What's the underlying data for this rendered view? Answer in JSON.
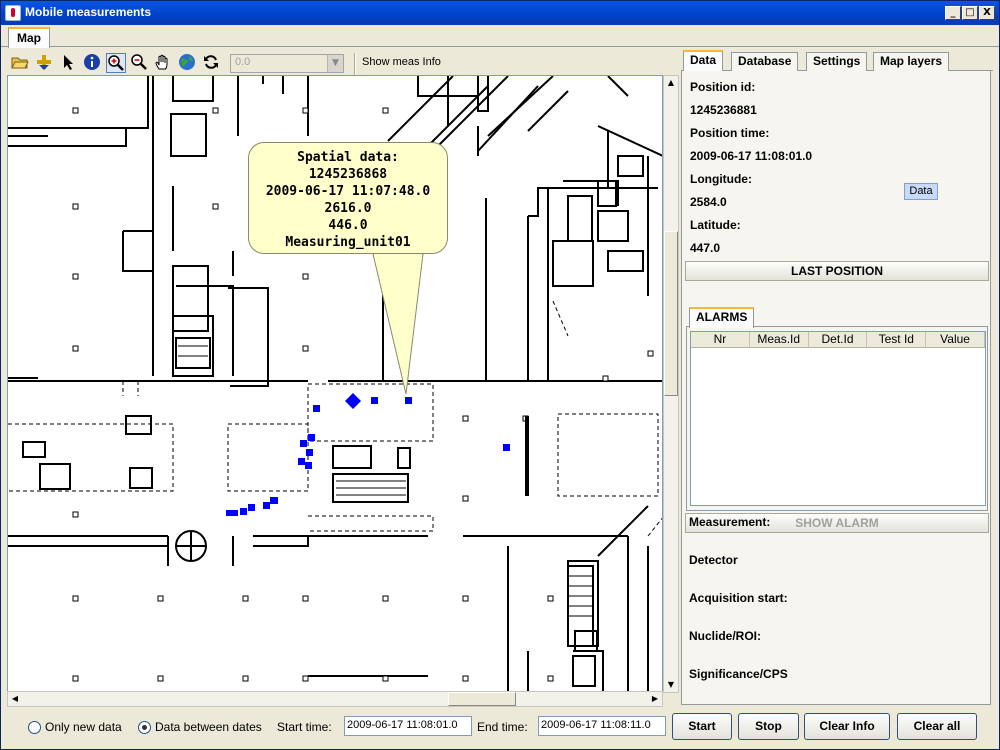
{
  "window": {
    "title": "Mobile measurements",
    "controls": [
      "_",
      "□",
      "X"
    ]
  },
  "top_tabs": [
    {
      "label": "Map",
      "active": true
    }
  ],
  "toolbar": {
    "tools": [
      "open-folder-icon",
      "add-point-icon",
      "pointer-icon",
      "info-icon",
      "zoom-in-icon",
      "zoom-out-icon",
      "pan-hand-icon",
      "globe-icon",
      "refresh-icon"
    ],
    "selected_tool": "zoom-in-icon",
    "zoom_combo_value": "0.0",
    "show_meas_info_label": "Show meas Info"
  },
  "map": {
    "callout": {
      "line1": "Spatial data:",
      "line2": "1245236868",
      "line3": "2009-06-17 11:07:48.0",
      "line4": "2616.0",
      "line5": "446.0",
      "line6": "Measuring_unit01"
    },
    "marker_color": "#0000ff",
    "callout_color": "#ffffcc"
  },
  "right_panel": {
    "tabs": [
      {
        "label": "Data",
        "active": true
      },
      {
        "label": "Database",
        "active": false
      },
      {
        "label": "Settings",
        "active": false
      },
      {
        "label": "Map layers",
        "active": false
      }
    ],
    "position_id_label": "Position id:",
    "position_id_value": "1245236881",
    "position_time_label": "Position time:",
    "position_time_value": "2009-06-17 11:08:01.0",
    "longitude_label": "Longitude:",
    "longitude_value": "2584.0",
    "latitude_label": "Latitude:",
    "latitude_value": "447.0",
    "data_badge": "Data",
    "last_position_button": "LAST POSITION",
    "alarms_tab": "ALARMS",
    "alarm_columns": [
      "Nr",
      "Meas.Id",
      "Det.Id",
      "Test Id",
      "Value"
    ],
    "show_alarm_button": "SHOW ALARM",
    "measurement_label": "Measurement:",
    "detector_label": "Detector",
    "acquisition_start_label": "Acquisition start:",
    "nuclide_label": "Nuclide/ROI:",
    "significance_label": "Significance/CPS"
  },
  "bottom_bar": {
    "radio_only_new": {
      "label": "Only new data",
      "selected": false
    },
    "radio_between_dates": {
      "label": "Data between dates",
      "selected": true
    },
    "start_time_label": "Start time:",
    "start_time_value": "2009-06-17 11:08:01.0",
    "end_time_label": "End time:",
    "end_time_value": "2009-06-17 11:08:11.0",
    "buttons": {
      "start": "Start",
      "stop": "Stop",
      "clear_info": "Clear Info",
      "clear_all": "Clear all"
    }
  }
}
